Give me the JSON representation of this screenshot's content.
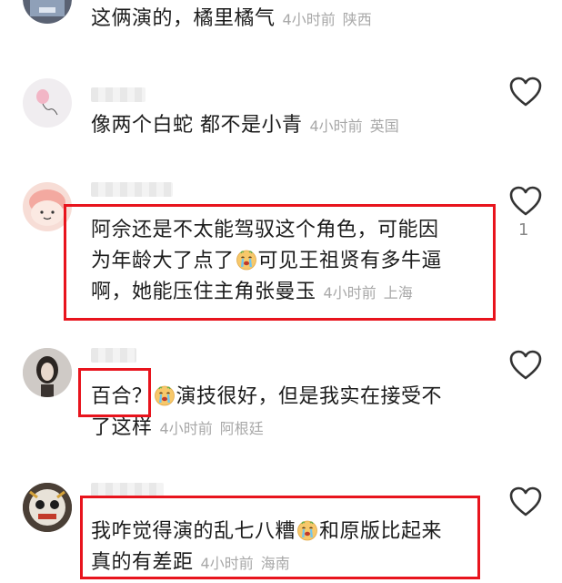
{
  "comments": [
    {
      "text": "这俩演的，橘里橘气",
      "time": "4小时前",
      "location": "陕西",
      "avatar_icon": "user-avatar-partial"
    },
    {
      "text": "像两个白蛇 都不是小青",
      "time": "4小时前",
      "location": "英国",
      "avatar_icon": "balloon-avatar"
    },
    {
      "line1": "阿佘还是不太能驾驭这个角色，可能因",
      "line2a": "为年龄大了点了",
      "line2b": "可见王祖贤有多牛逼",
      "line3": "啊，她能压住主角张曼玉",
      "time": "4小时前",
      "location": "上海",
      "likes": "1",
      "avatar_icon": "cartoon-face-avatar",
      "emoji": "crying-face-emoji"
    },
    {
      "line1a": "百合？",
      "line1b": "演技很好，但是我实在接受不",
      "line2": "了这样",
      "time": "4小时前",
      "location": "阿根廷",
      "avatar_icon": "girl-photo-avatar",
      "emoji": "crying-face-emoji"
    },
    {
      "line1a": "我咋觉得演的乱七八糟",
      "line1b": "和原版比起来",
      "line2": "真的有差距",
      "time": "4小时前",
      "location": "海南",
      "avatar_icon": "lion-dance-avatar",
      "emoji": "crying-face-emoji"
    }
  ],
  "colors": {
    "highlight_box": "#e8141d",
    "meta_text": "#a8a8a8",
    "heart_outline": "#333333"
  }
}
